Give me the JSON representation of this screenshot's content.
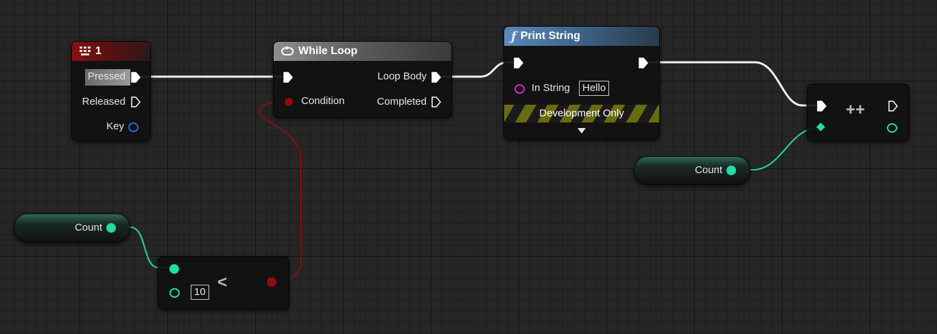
{
  "key_event": {
    "title": "1",
    "pins": {
      "pressed": "Pressed",
      "released": "Released",
      "key": "Key"
    },
    "header_icon": "keyboard-key-icon"
  },
  "while_loop": {
    "title": "While Loop",
    "header_icon": "loop-icon",
    "pins": {
      "condition": "Condition",
      "loop_body": "Loop Body",
      "completed": "Completed"
    }
  },
  "print_string": {
    "title": "Print String",
    "header_icon": "function-icon",
    "function_glyph": "ƒ",
    "pins": {
      "in_string": "In String"
    },
    "in_string_value": "Hello",
    "dev_only": "Development Only",
    "expand_icon": "triangle-down-icon"
  },
  "increment_node": {
    "operator": "++"
  },
  "compare_node": {
    "operator": "<",
    "literal_value": "10"
  },
  "count_var_top": {
    "label": "Count"
  },
  "count_var_bottom": {
    "label": "Count"
  },
  "colors": {
    "exec": "#ffffff",
    "bool": "#8c0d0d",
    "int": "#1fdcaa",
    "key_struct": "#1e6fd8",
    "string": "#e21fd8",
    "grid_major": "#111111",
    "background": "#262626"
  }
}
